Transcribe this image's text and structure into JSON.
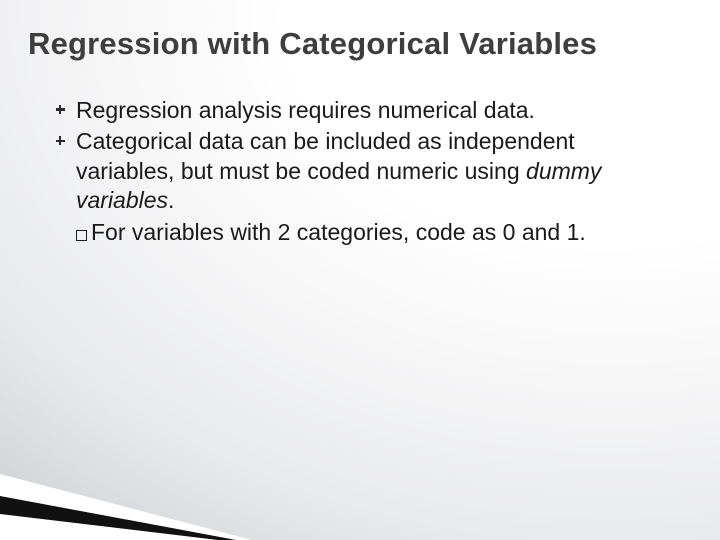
{
  "title": "Regression with Categorical Variables",
  "bullets": [
    {
      "text": "Regression analysis requires numerical data."
    },
    {
      "text_before": "Categorical data can be included as independent variables, but must be coded numeric using ",
      "italic": "dummy variables",
      "text_after": "."
    }
  ],
  "sub": {
    "text": "For variables with 2 categories, code as 0 and 1."
  }
}
